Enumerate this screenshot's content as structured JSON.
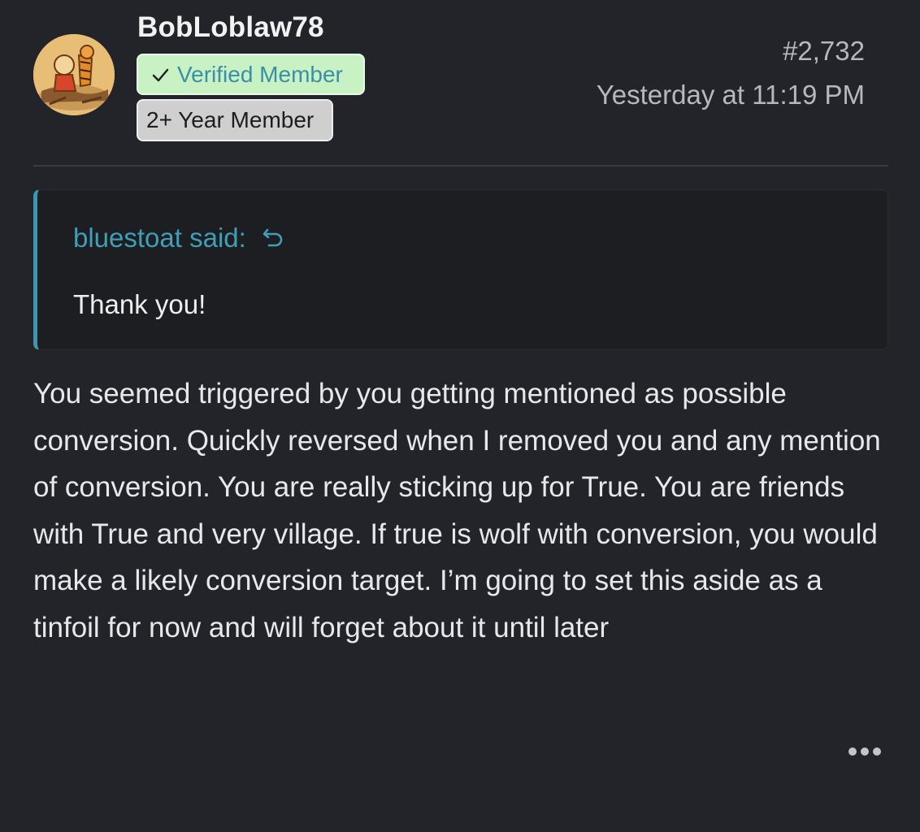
{
  "post": {
    "username": "BobLoblaw78",
    "badges": {
      "verified_label": "Verified Member",
      "year_label": "2+ Year Member"
    },
    "post_number": "#2,732",
    "date": "Yesterday at 11:19 PM",
    "quote": {
      "attribution": "bluestoat said:",
      "text": "Thank you!"
    },
    "message": "You seemed triggered by you getting mentioned as possible conversion. Quickly reversed when I removed you and any mention of conversion. You are really sticking up for True. You are friends with True and very village. If true is wolf with conversion, you would make a likely conversion target. I’m going to set this aside as a tinfoil for now and will forget about it until later"
  },
  "icons": {
    "verified": "check-icon",
    "quote_jump": "jump-to-quote-icon",
    "more": "more-options-icon"
  },
  "colors": {
    "background": "#232429",
    "accent": "#3f9fb8",
    "verified_badge_bg": "#c8f2c4",
    "year_badge_bg": "#cfcfcf"
  }
}
